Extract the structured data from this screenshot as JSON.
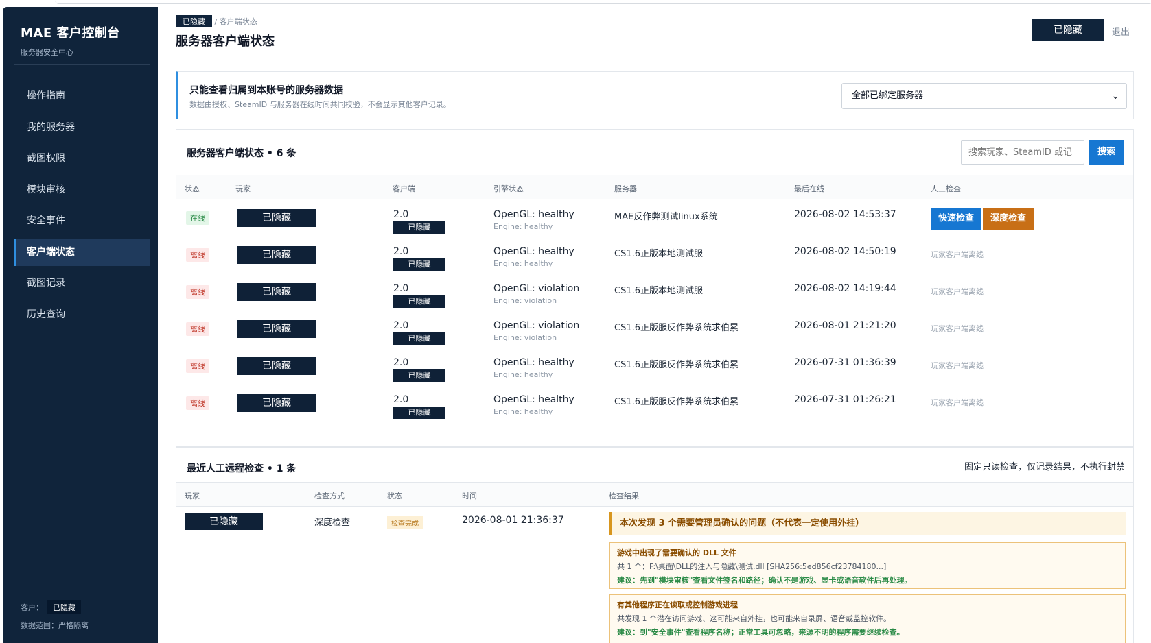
{
  "sidebar": {
    "title": "MAE 客户控制台",
    "subtitle": "服务器安全中心",
    "items": [
      {
        "label": "操作指南"
      },
      {
        "label": "我的服务器"
      },
      {
        "label": "截图权限"
      },
      {
        "label": "模块审核"
      },
      {
        "label": "安全事件"
      },
      {
        "label": "客户端状态"
      },
      {
        "label": "截图记录"
      },
      {
        "label": "历史查询"
      }
    ],
    "active_index": 5,
    "footer_customer_label": "客户：",
    "footer_customer_value": "已隐藏",
    "footer_scope": "数据范围：严格隔离"
  },
  "header": {
    "breadcrumb_chip": "已隐藏",
    "breadcrumb_current": "/ 客户端状态",
    "title": "服务器客户端状态",
    "user_chip": "已隐藏",
    "logout": "退出"
  },
  "notice": {
    "title": "只能查看归属到本账号的服务器数据",
    "subtitle": "数据由授权、SteamID 与服务器在线时间共同校验，不会显示其他客户记录。",
    "select_value": "全部已绑定服务器"
  },
  "client_panel": {
    "title": "服务器客户端状态 • 6 条",
    "search_placeholder": "搜索玩家、SteamID 或记",
    "search_button": "搜索",
    "columns": [
      "状态",
      "玩家",
      "客户端",
      "引擎状态",
      "服务器",
      "最后在线",
      "人工检查"
    ],
    "rows": [
      {
        "status": "在线",
        "online": true,
        "player": "已隐藏",
        "client_ver": "2.0",
        "client_chip": "已隐藏",
        "engine": "OpenGL: healthy",
        "engine_sub": "Engine: healthy",
        "server": "MAE反作弊测试linux系统",
        "last_seen": "2026-08-02 14:53:37",
        "quick": "快速检查",
        "deep": "深度检查",
        "note": ""
      },
      {
        "status": "离线",
        "online": false,
        "player": "已隐藏",
        "client_ver": "2.0",
        "client_chip": "已隐藏",
        "engine": "OpenGL: healthy",
        "engine_sub": "Engine: healthy",
        "server": "CS1.6正版本地测试服",
        "last_seen": "2026-08-02 14:50:19",
        "note": "玩家客户端离线"
      },
      {
        "status": "离线",
        "online": false,
        "player": "已隐藏",
        "client_ver": "2.0",
        "client_chip": "已隐藏",
        "engine": "OpenGL: violation",
        "engine_sub": "Engine: violation",
        "server": "CS1.6正版本地测试服",
        "last_seen": "2026-08-02 14:19:44",
        "note": "玩家客户端离线"
      },
      {
        "status": "离线",
        "online": false,
        "player": "已隐藏",
        "client_ver": "2.0",
        "client_chip": "已隐藏",
        "engine": "OpenGL: violation",
        "engine_sub": "Engine: violation",
        "server": "CS1.6正版服反作弊系统求伯累",
        "last_seen": "2026-08-01 21:21:20",
        "note": "玩家客户端离线"
      },
      {
        "status": "离线",
        "online": false,
        "player": "已隐藏",
        "client_ver": "2.0",
        "client_chip": "已隐藏",
        "engine": "OpenGL: healthy",
        "engine_sub": "Engine: healthy",
        "server": "CS1.6正版服反作弊系统求伯累",
        "last_seen": "2026-07-31 01:36:39",
        "note": "玩家客户端离线"
      },
      {
        "status": "离线",
        "online": false,
        "player": "已隐藏",
        "client_ver": "2.0",
        "client_chip": "已隐藏",
        "engine": "OpenGL: healthy",
        "engine_sub": "Engine: healthy",
        "server": "CS1.6正版服反作弊系统求伯累",
        "last_seen": "2026-07-31 01:26:21",
        "note": "玩家客户端离线"
      }
    ]
  },
  "remote_panel": {
    "title": "最近人工远程检查 • 1 条",
    "note": "固定只读检查，仅记录结果，不执行封禁",
    "columns": [
      "玩家",
      "检查方式",
      "状态",
      "时间",
      "检查结果"
    ],
    "row": {
      "player": "已隐藏",
      "method": "深度检查",
      "status": "检查完成",
      "time": "2026-08-01 21:36:37",
      "result_main": "本次发现 3 个需要管理员确认的问题（不代表一定使用外挂）",
      "findings": [
        {
          "title": "游戏中出现了需要确认的 DLL 文件",
          "desc": "共 1 个：F:\\桌面\\DLL的注入与隐藏\\测试.dll [SHA256:5ed856cf23784180...]",
          "suggestion": "建议：先到\"模块审核\"查看文件签名和路径；确认不是游戏、显卡或语音软件后再处理。"
        },
        {
          "title": "有其他程序正在读取或控制游戏进程",
          "desc": "共发现 1 个潜在访问游戏、这可能来自外挂，也可能来自录屏、语音或监控软件。",
          "suggestion": "建议：到\"安全事件\"查看程序名称；正常工具可忽略，来源不明的程序需要继续检查。"
        }
      ]
    }
  }
}
